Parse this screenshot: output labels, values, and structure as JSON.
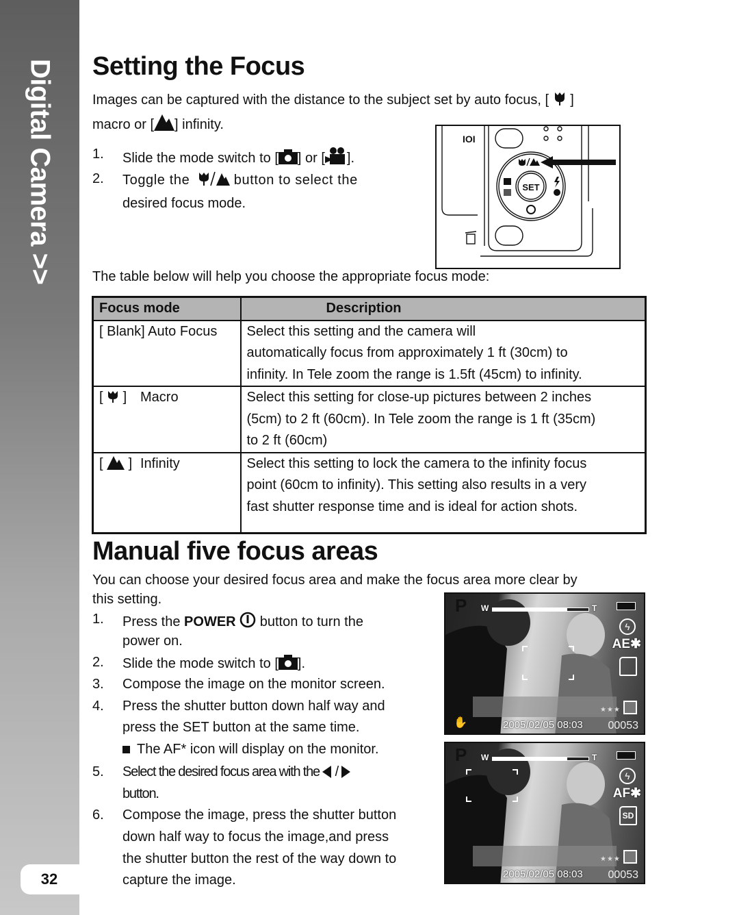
{
  "sidebar": {
    "section_title": "Digital Camera >>",
    "page_number": "32"
  },
  "section1": {
    "title": "Setting the Focus",
    "intro_line1": "Images can be captured with the distance to the subject set by auto focus, [",
    "intro_line1_end": "]",
    "intro_line2_start": "macro or [",
    "intro_line2_end": "] infinity.",
    "steps": [
      {
        "num": "1.",
        "text_a": "Slide the mode switch to [",
        "text_b": "] or [",
        "text_c": "]."
      },
      {
        "num": "2.",
        "text_a": "Toggle the",
        "text_b": "button to select the",
        "text_c": "desired focus mode."
      }
    ],
    "table_intro": "The table below will help you choose the appropriate focus mode:",
    "diagram": {
      "set_label": "SET",
      "button_icon": "macro-infinity-icon"
    },
    "table": {
      "headers": [
        "Focus mode",
        "Description"
      ],
      "rows": [
        {
          "mode_prefix": "[ Blank] Auto Focus",
          "mode_label": "",
          "icon": "",
          "description": [
            "Select this setting and the camera will",
            "automatically focus from approximately 1 ft (30cm) to",
            "infinity.  In Tele zoom the range is 1.5ft (45cm) to infinity."
          ]
        },
        {
          "mode_prefix": "",
          "mode_label": "Macro",
          "icon": "macro-flower-icon",
          "description": [
            "Select this setting for close-up pictures between 2 inches",
            "(5cm) to 2 ft (60cm).  In Tele zoom the range is 1 ft (35cm)",
            "to 2 ft (60cm)"
          ]
        },
        {
          "mode_prefix": "",
          "mode_label": "Infinity",
          "icon": "infinity-mountain-icon",
          "description": [
            "Select this setting to lock the camera to the infinity focus",
            "point (60cm to infinity).  This setting also results in a very",
            "fast shutter response time and is ideal for action shots."
          ]
        }
      ]
    }
  },
  "section2": {
    "title": "Manual five focus areas",
    "intro_line1": "You can choose your desired focus area and make the focus area more clear by",
    "intro_line2": "this setting.",
    "steps": [
      {
        "num": "1.",
        "lines": [
          "Press the ",
          "POWER",
          " button to turn the",
          "power on."
        ]
      },
      {
        "num": "2.",
        "lines": [
          "Slide the mode switch to [",
          "]."
        ]
      },
      {
        "num": "3.",
        "lines": [
          "Compose the image on the monitor screen."
        ]
      },
      {
        "num": "4.",
        "lines": [
          "Press the shutter button down half way and",
          "press the SET button at the same time."
        ]
      },
      {
        "num": "",
        "lines": [
          "The AF* icon will display on the monitor."
        ]
      },
      {
        "num": "5.",
        "lines": [
          "Select the desired focus area with the",
          "/",
          "button."
        ]
      },
      {
        "num": "6.",
        "lines": [
          "Compose the image, press the shutter button",
          "down half way to focus the image,and press",
          "the shutter button the rest of the way down to",
          "capture the image."
        ]
      }
    ],
    "screens": [
      {
        "mode": "P",
        "zoom_w": "W",
        "zoom_t": "T",
        "zoom_level": 0.78,
        "exposure_label": "AE",
        "storage": "",
        "quality": "★★★",
        "datetime": "2005/02/05 08:03",
        "shots": "00053"
      },
      {
        "mode": "P",
        "zoom_w": "W",
        "zoom_t": "T",
        "zoom_level": 0.78,
        "exposure_label": "AF",
        "storage": "SD",
        "quality": "★★★",
        "datetime": "2005/02/05 08:03",
        "shots": "00053"
      }
    ]
  }
}
